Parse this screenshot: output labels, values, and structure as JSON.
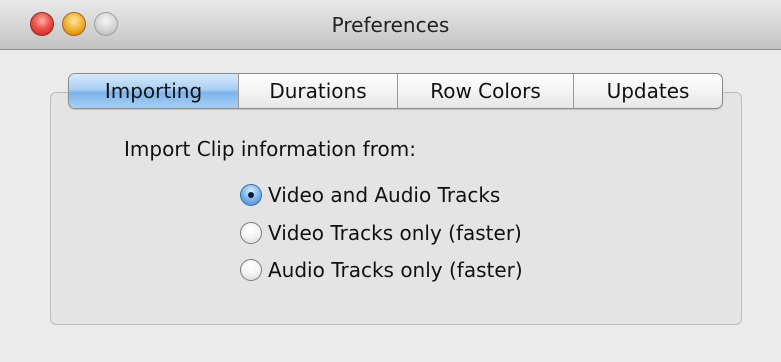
{
  "window": {
    "title": "Preferences",
    "controls": {
      "close_color": "#f0514a",
      "minimize_color": "#f6b53a",
      "zoom_color": "#d4d4d4"
    }
  },
  "tabs": [
    {
      "label": "Importing",
      "selected": true
    },
    {
      "label": "Durations",
      "selected": false
    },
    {
      "label": "Row Colors",
      "selected": false
    },
    {
      "label": "Updates",
      "selected": false
    }
  ],
  "importing": {
    "heading": "Import Clip information from:",
    "options": [
      {
        "label": "Video and Audio Tracks",
        "checked": true
      },
      {
        "label": "Video Tracks only (faster)",
        "checked": false
      },
      {
        "label": "Audio Tracks only (faster)",
        "checked": false
      }
    ]
  },
  "colors": {
    "selected_tab": "#a9cff4",
    "window_bg": "#ebebeb"
  }
}
